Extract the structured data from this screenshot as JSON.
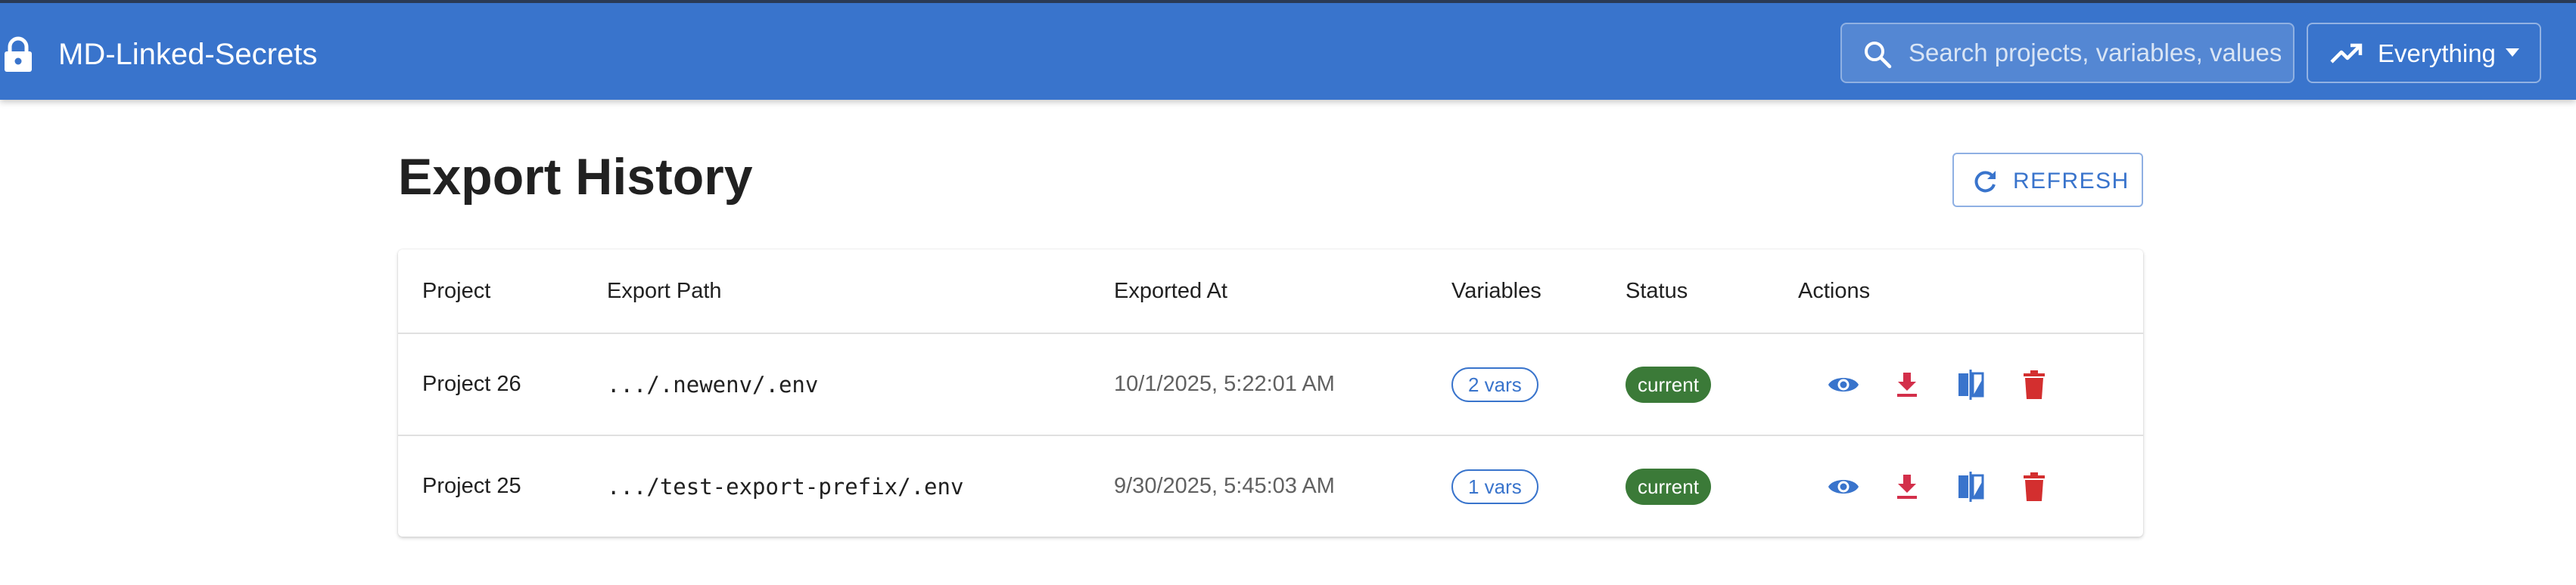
{
  "app": {
    "title": "MD-Linked-Secrets",
    "icon": "lock-icon"
  },
  "search": {
    "placeholder": "Search projects, variables, values",
    "value": "",
    "icon": "search-icon"
  },
  "mode_selector": {
    "label": "Everything",
    "icon": "trending-up-icon"
  },
  "page": {
    "title": "Export History",
    "refresh_label": "REFRESH"
  },
  "table": {
    "columns": [
      "Project",
      "Export Path",
      "Exported At",
      "Variables",
      "Status",
      "Actions"
    ],
    "rows": [
      {
        "project": "Project 26",
        "path": ".../.newenv/.env",
        "exported_at": "10/1/2025, 5:22:01 AM",
        "variables": "2 vars",
        "status": "current"
      },
      {
        "project": "Project 25",
        "path": ".../test-export-prefix/.env",
        "exported_at": "9/30/2025, 5:45:03 AM",
        "variables": "1 vars",
        "status": "current"
      }
    ],
    "actions": [
      "view-icon",
      "download-icon",
      "compare-icon",
      "delete-icon"
    ]
  },
  "colors": {
    "appbar": "#3974cc",
    "primary": "#3974cc",
    "status_current": "#3b7a38",
    "download": "#d32f4a",
    "delete": "#d32f2f"
  }
}
